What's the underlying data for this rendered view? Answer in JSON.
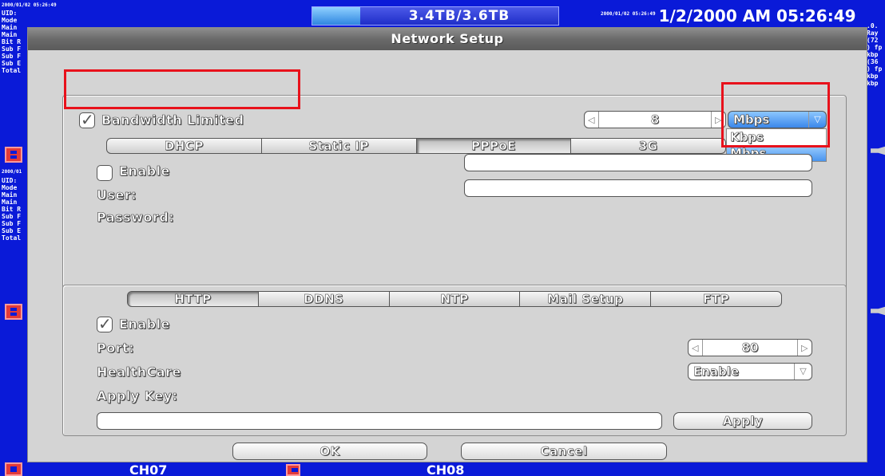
{
  "background": {
    "top_left_timestamp": "2000/01/02 05:26:49",
    "mid_left_timestamp": "2000/01",
    "osd_lines": [
      "UID:",
      "Mode",
      "Main",
      "Main",
      "Bit R",
      "Sub F",
      "Sub F",
      "Sub E",
      "Total"
    ],
    "right_osd_lines": [
      ".0.",
      "Ray",
      "(72",
      ") fp",
      "kbp",
      "(36",
      ") fp",
      "kbp",
      "kbp"
    ],
    "storage": "3.4TB/3.6TB",
    "clock_small": "2000/01/02 05:26:49",
    "clock": "1/2/2000 AM 05:26:49",
    "channels": [
      "CH07",
      "CH08"
    ]
  },
  "dialog": {
    "title": "Network Setup",
    "bandwidth": {
      "label": "Bandwidth Limited",
      "checked": true,
      "value": "8",
      "unit_selected": "Mbps",
      "unit_options": [
        "Kbps",
        "Mbps"
      ]
    },
    "connection_tabs": [
      "DHCP",
      "Static IP",
      "PPPoE",
      "3G"
    ],
    "active_connection_tab": "PPPoE",
    "pppoe": {
      "enable_label": "Enable",
      "enable_checked": false,
      "user_label": "User:",
      "user_value": "",
      "password_label": "Password:",
      "password_value": ""
    },
    "service_tabs": [
      "HTTP",
      "DDNS",
      "NTP",
      "Mail Setup",
      "FTP"
    ],
    "active_service_tab": "HTTP",
    "http": {
      "enable_label": "Enable",
      "enable_checked": true,
      "port_label": "Port:",
      "port_value": "80",
      "healthcare_label": "HealthCare",
      "healthcare_value": "Enable",
      "apply_key_label": "Apply Key:",
      "apply_key_value": "",
      "apply_button": "Apply"
    },
    "ok_button": "OK",
    "cancel_button": "Cancel"
  },
  "colors": {
    "screen_background": "#0a1ad8",
    "dialog_background": "#d4d4d4",
    "highlight_box": "#e8111b",
    "selected_option": "#4a95ee"
  }
}
